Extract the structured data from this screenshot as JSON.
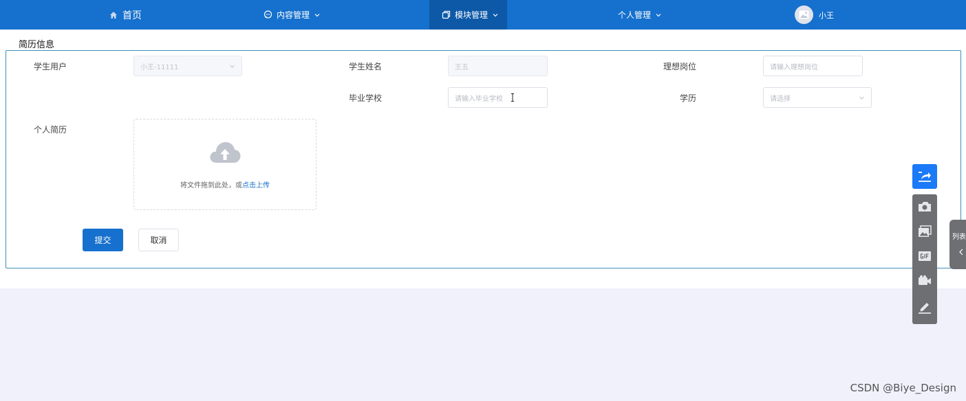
{
  "nav": {
    "items": [
      {
        "label": "首页",
        "icon": "home-icon"
      },
      {
        "label": "内容管理",
        "icon": "chat-icon"
      },
      {
        "label": "模块管理",
        "icon": "copy-icon"
      },
      {
        "label": "个人管理",
        "icon": ""
      }
    ],
    "user": {
      "name": "小王",
      "icon": "image-icon"
    },
    "active_color": "#0d59a8",
    "bar_color": "#1670cd"
  },
  "page": {
    "floating_label": "简历信息"
  },
  "form": {
    "student_user": {
      "label": "学生用户",
      "value": "小王-11111"
    },
    "student_name": {
      "label": "学生姓名",
      "value": "王五"
    },
    "ideal_position": {
      "label": "理想岗位",
      "placeholder": "请输入理想岗位"
    },
    "school": {
      "label": "毕业学校",
      "placeholder": "请输入毕业学校"
    },
    "education": {
      "label": "学历",
      "placeholder": "请选择"
    },
    "resume": {
      "label": "个人简历",
      "upload_text": "将文件拖到此处，或",
      "upload_link": "点击上传"
    },
    "submit_label": "提交",
    "cancel_label": "取消"
  },
  "side_tab": {
    "label": "列表"
  },
  "watermark": "CSDN @Biye_Design"
}
